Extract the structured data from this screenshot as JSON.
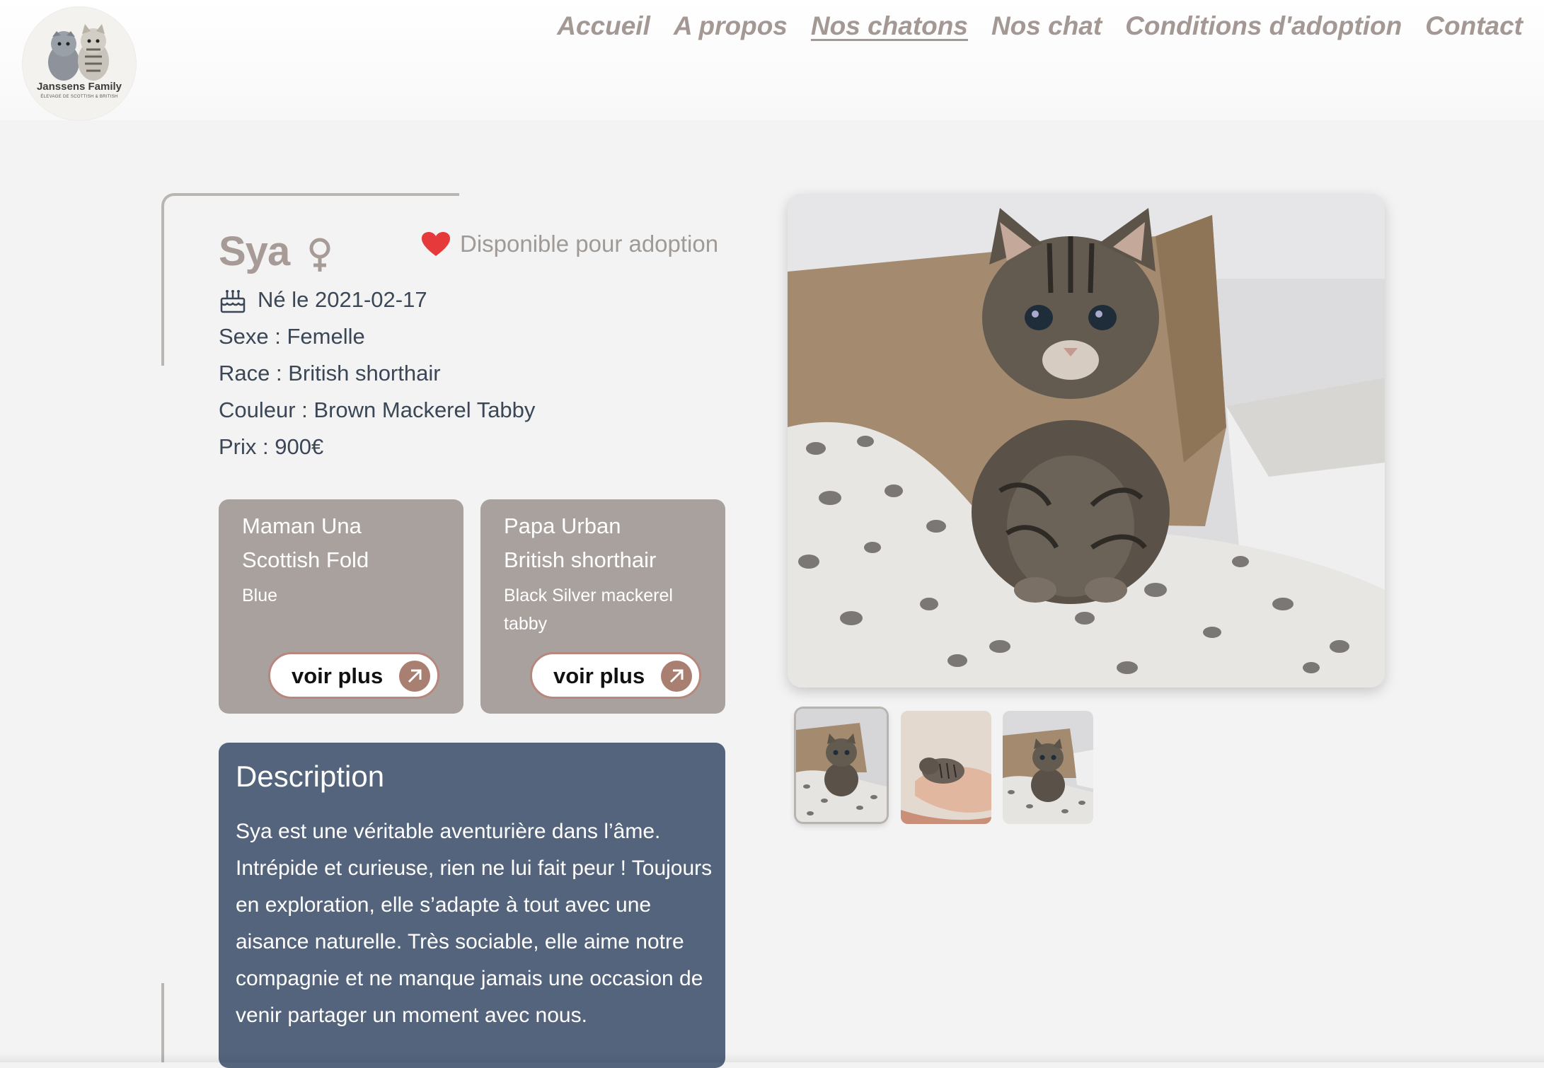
{
  "brand": {
    "name": "Janssens Family",
    "tagline": "ÉLEVAGE DE SCOTTISH & BRITISH"
  },
  "nav": {
    "items": [
      {
        "label": "Accueil",
        "active": false
      },
      {
        "label": "A propos",
        "active": false
      },
      {
        "label": "Nos chatons",
        "active": true
      },
      {
        "label": "Nos chat",
        "active": false
      },
      {
        "label": "Conditions d'adoption",
        "active": false
      },
      {
        "label": "Contact",
        "active": false
      }
    ]
  },
  "kitten": {
    "name": "Sya",
    "gender_symbol": "female-icon",
    "status": "Disponible pour adoption",
    "birth": "Né le 2021-02-17",
    "sex": "Sexe : Femelle",
    "breed": "Race : British shorthair",
    "color": "Couleur : Brown Mackerel Tabby",
    "price": "Prix : 900€"
  },
  "parents": {
    "mother": {
      "name": "Maman Una",
      "breed": "Scottish Fold",
      "color": "Blue",
      "button": "voir plus"
    },
    "father": {
      "name": "Papa Urban",
      "breed": "British shorthair",
      "color": "Black Silver mackerel tabby",
      "button": "voir plus"
    }
  },
  "description": {
    "title": "Description",
    "body": "Sya est une véritable aventurière dans l’âme. Intrépide et curieuse, rien ne lui fait peur ! Toujours en exploration, elle s’adapte à tout avec une aisance naturelle. Très sociable, elle aime notre compagnie et ne manque jamais une occasion de venir partager un moment avec nous."
  },
  "gallery": {
    "selected": 1,
    "count": 3
  },
  "colors": {
    "nav_text": "#a39893",
    "heading": "#a79b97",
    "body_text": "#3b4756",
    "card_bg": "#a9a19e",
    "description_bg": "#54647c",
    "button_border": "#b7867d",
    "heart": "#e5393c"
  }
}
